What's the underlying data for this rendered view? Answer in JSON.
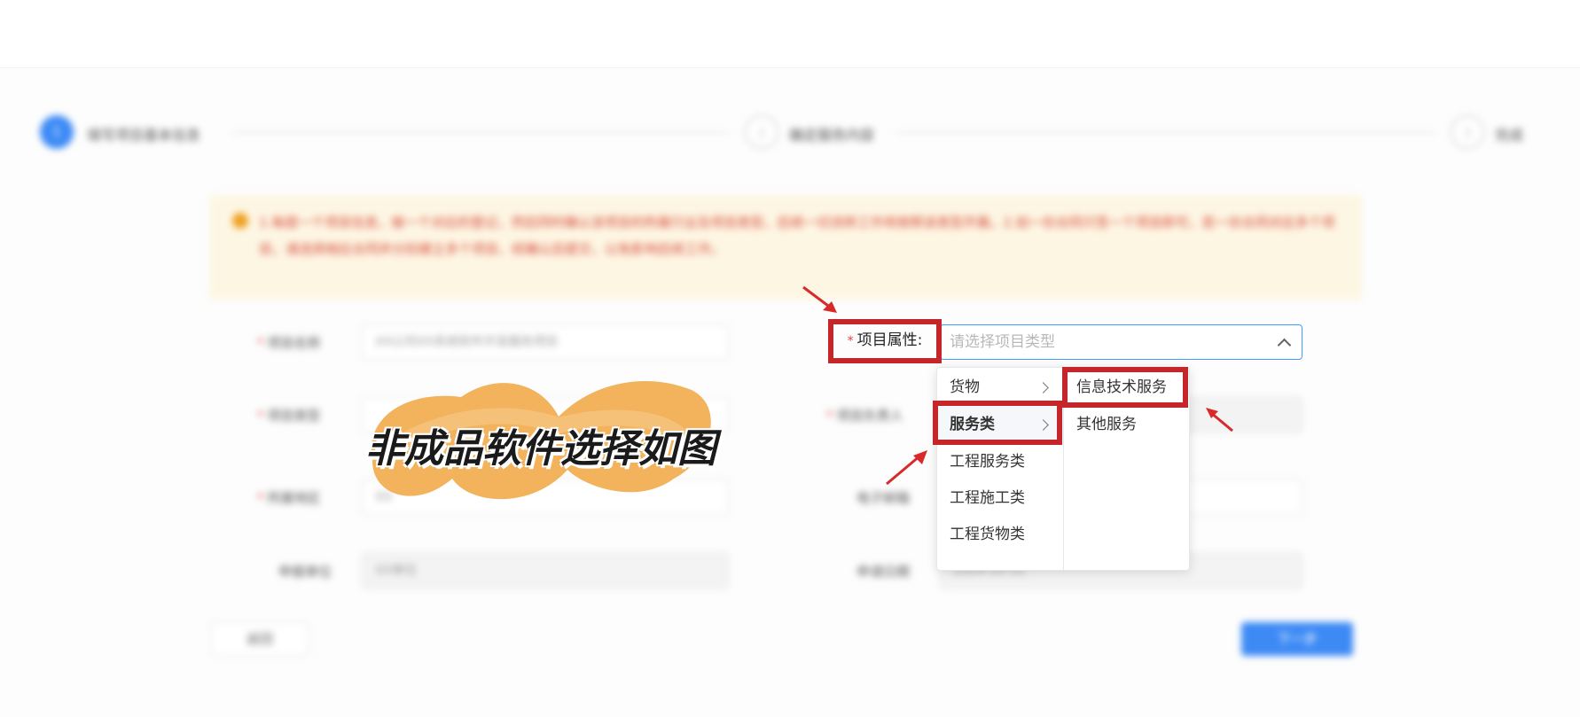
{
  "steps": [
    {
      "number": "1",
      "label": "填写项目基本信息"
    },
    {
      "number": "2",
      "label": "确定服务内容"
    },
    {
      "number": "3",
      "label": "完成"
    }
  ],
  "notice": {
    "text": "1.每提一个项目信息，做一个对应的登记，然后同时确认该项目的所属行业及项目类型，后续一切流转工作将按照该类型开展。2.如一份合同只签一个项目即可，若一份合同对应多个项目，请选择相应合同并分别建立多个项目，经确认后提交，以免影响后续工作。"
  },
  "form": {
    "fields": [
      {
        "label": "项目名称",
        "required": true,
        "value": "XX公司XX系统软件开发服务项目"
      },
      {
        "label": "项目类型",
        "required": true,
        "value": ""
      },
      {
        "label": "所属地区",
        "required": true,
        "value": "XX"
      },
      {
        "label": "申报单位",
        "required": false,
        "value": "XX单位"
      }
    ],
    "right_fields": [
      {
        "label": "项目负责人",
        "required": true,
        "value": ""
      },
      {
        "label": "电子邮箱",
        "required": false,
        "value": ""
      },
      {
        "label": "申请日期",
        "required": false,
        "value": "2024-10-10"
      }
    ],
    "back_label": "返回",
    "next_label": "下一步"
  },
  "project_attr": {
    "required_mark": "*",
    "label": "项目属性:",
    "placeholder": "请选择项目类型"
  },
  "cascader": {
    "level1": [
      {
        "label": "货物",
        "has_children": true
      },
      {
        "label": "服务类",
        "has_children": true,
        "active": true
      },
      {
        "label": "工程服务类",
        "has_children": false
      },
      {
        "label": "工程施工类",
        "has_children": false
      },
      {
        "label": "工程货物类",
        "has_children": false
      }
    ],
    "level2": [
      {
        "label": "信息技术服务",
        "highlighted": true
      },
      {
        "label": "其他服务"
      }
    ]
  },
  "annotation": {
    "text": "非成品软件选择如图",
    "highlight_color": "#c4262a",
    "sticker_color": "#f2b35c"
  }
}
